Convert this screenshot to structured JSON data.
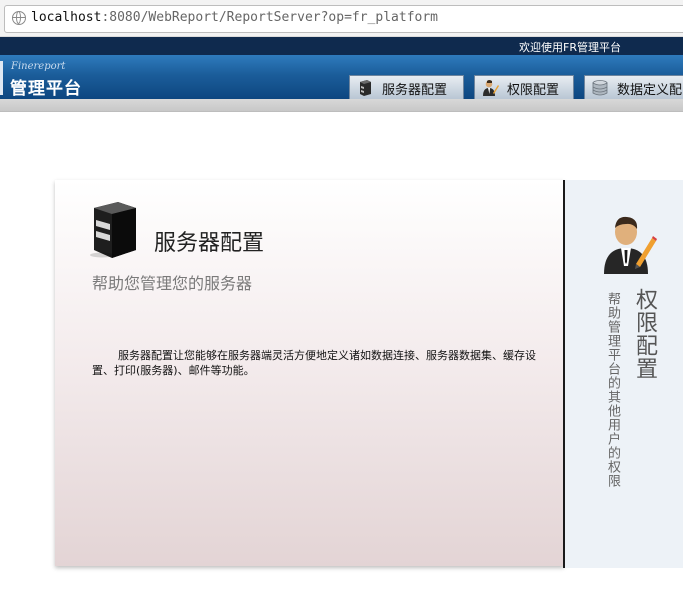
{
  "browser": {
    "url_host": "localhost",
    "url_path": ":8080/WebReport/ReportServer?op=fr_platform"
  },
  "header": {
    "welcome": "欢迎使用FR管理平台",
    "logo_sub": "Finereport",
    "logo_main": "管理平台"
  },
  "tabs": [
    {
      "label": "服务器配置",
      "icon": "server-icon"
    },
    {
      "label": "权限配置",
      "icon": "user-icon"
    },
    {
      "label": "数据定义配",
      "icon": "database-icon"
    }
  ],
  "main_panel": {
    "title": "服务器配置",
    "subtitle": "帮助您管理您的服务器",
    "description": "服务器配置让您能够在服务器端灵活方便地定义诸如数据连接、服务器数据集、缓存设置、打印(服务器)、邮件等功能。",
    "icon": "server-icon"
  },
  "side_panel": {
    "title": "权限配置",
    "description": "帮助管理平台的其他用户的权限",
    "icon": "user-edit-icon"
  },
  "colors": {
    "header_dark": "#0f2a4e",
    "header_blue": "#1b5d9a",
    "side_bg": "#edf2f7"
  }
}
